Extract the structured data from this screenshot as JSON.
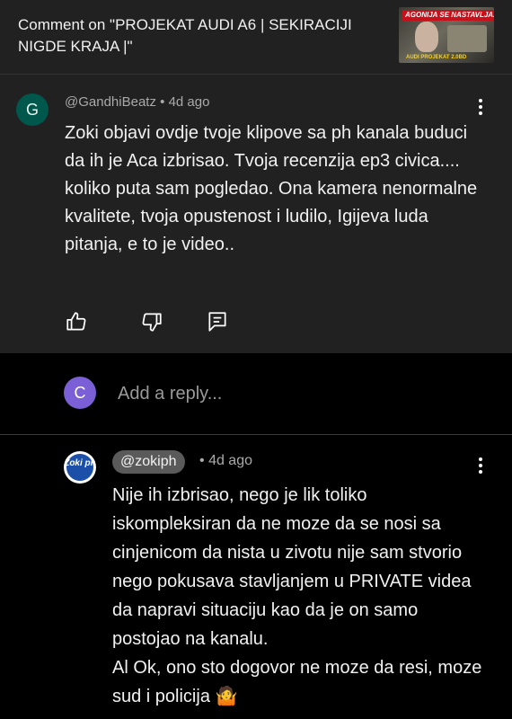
{
  "header": {
    "title": "Comment on \"PROJEKAT AUDI A6 | SEKIRACIJI NIGDE KRAJA |\"",
    "thumbnail_banner": "AGONIJA SE NASTAVLJA...",
    "thumbnail_caption": "AUDI PROJEKAT 2.0BD"
  },
  "comment": {
    "avatar_letter": "G",
    "avatar_color": "#00574b",
    "author": "@GandhiBeatz",
    "separator": "•",
    "time": "4d ago",
    "text": "Zoki objavi ovdje tvoje klipove sa ph kanala buduci da ih je Aca izbrisao. Tvoja recenzija ep3 civica.... koliko puta sam pogledao. Ona kamera nenormalne kvalitete, tvoja opustenost i ludilo, Igijeva luda pitanja, e to je video..",
    "actions": [
      "like-icon",
      "dislike-icon",
      "reply-icon"
    ]
  },
  "reply_box": {
    "avatar_letter": "C",
    "avatar_color": "#7b5fd6",
    "placeholder": "Add a reply..."
  },
  "reply": {
    "avatar_text": "Zoki ph",
    "author": "@zokiph",
    "separator": "•",
    "time": "4d ago",
    "text": "Nije ih izbrisao, nego je lik toliko iskompleksiran da ne moze da se nosi sa cinjenicom da nista u zivotu nije sam stvorio nego pokusava stavljanjem u PRIVATE videa da napravi situaciju kao da je on samo postojao na kanalu.\nAl Ok, ono sto dogovor ne moze da resi, moze sud i policija 🤷"
  },
  "colors": {
    "background": "#000000",
    "surface": "#212121",
    "text_primary": "#f1f1f1",
    "text_secondary": "#aaaaaa"
  }
}
